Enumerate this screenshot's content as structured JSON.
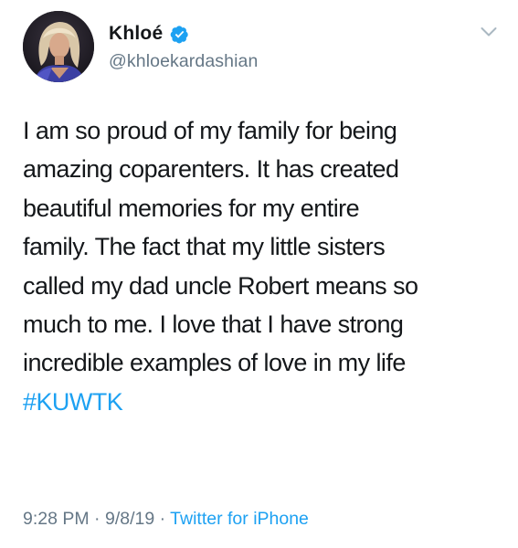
{
  "author": {
    "display_name": "Khloé",
    "handle": "@khloekardashian",
    "verified": true,
    "avatar_icon": "profile-photo",
    "verified_icon": "verified-badge-icon",
    "menu_icon": "chevron-down-icon"
  },
  "tweet": {
    "lines": [
      "I am so proud of my family for being",
      "amazing coparenters. It has created",
      "beautiful memories for my entire",
      "family. The fact that my little sisters",
      "called my dad uncle Robert means so",
      "much to me. I love that I have strong",
      "incredible examples of love in my life"
    ],
    "hashtag": "#KUWTK"
  },
  "meta": {
    "time": "9:28 PM",
    "separator": " · ",
    "date": "9/8/19",
    "source": "Twitter for iPhone"
  },
  "colors": {
    "text": "#14171a",
    "muted": "#657786",
    "accent": "#1da1f2",
    "background": "#ffffff"
  }
}
